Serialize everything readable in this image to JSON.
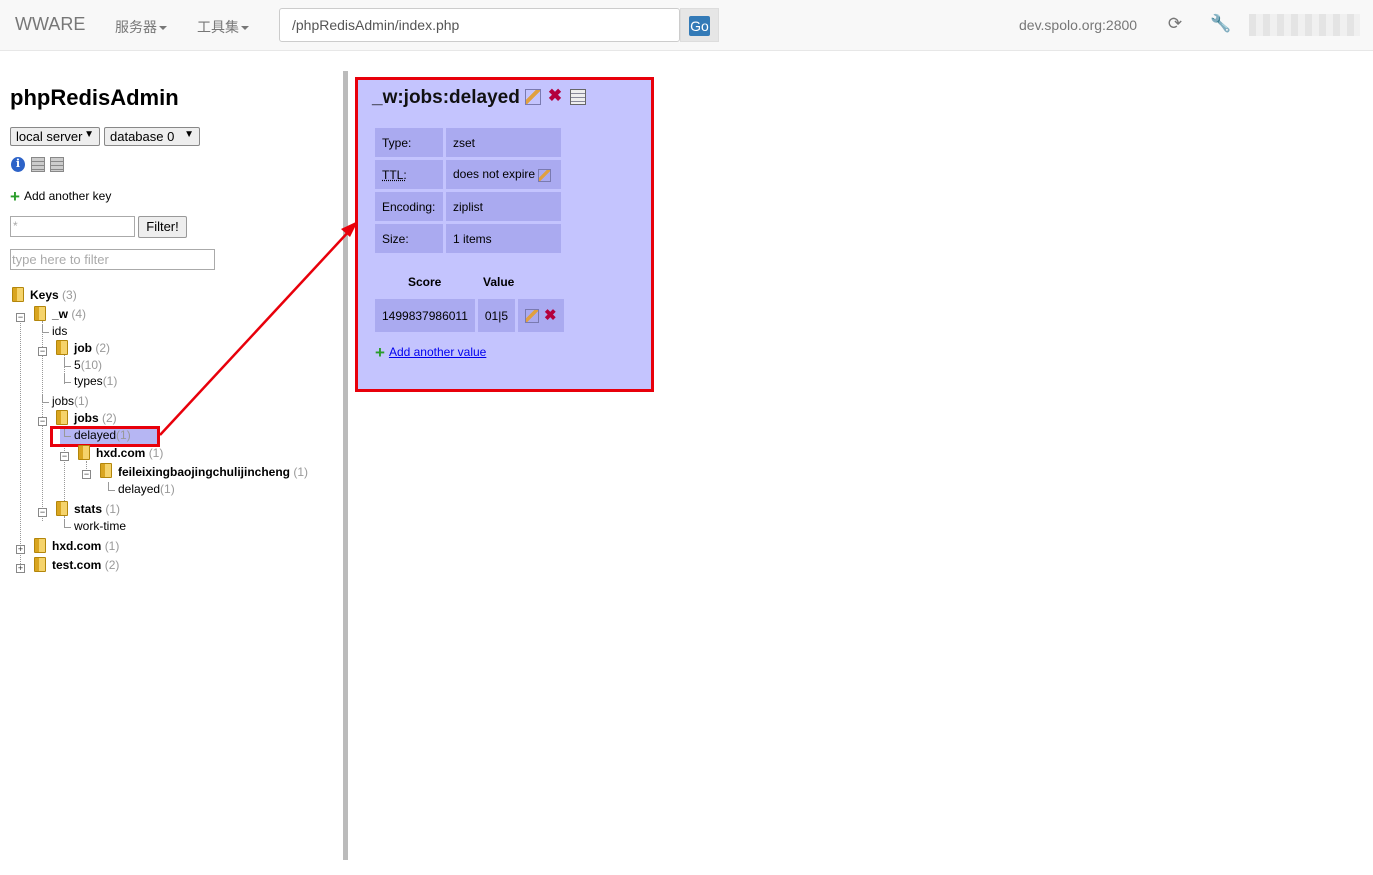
{
  "topbar": {
    "brand": "WWARE",
    "menu_servers": "服务器",
    "menu_tools": "工具集",
    "url": "/phpRedisAdmin/index.php",
    "go": "Go",
    "host": "dev.spolo.org:2800"
  },
  "sidebar": {
    "title": "phpRedisAdmin",
    "server_select": "local server",
    "database_select": "database 0",
    "add_key": "Add another key",
    "filter_value": "*",
    "filter_button": "Filter!",
    "type_filter_placeholder": "type here to filter"
  },
  "tree": {
    "keys": {
      "label": "Keys",
      "count": "(3)"
    },
    "w": {
      "label": "_w",
      "count": "(4)"
    },
    "ids": {
      "label": "ids"
    },
    "job": {
      "label": "job",
      "count": "(2)"
    },
    "job5": {
      "label": "5",
      "count": "(10)"
    },
    "types": {
      "label": "types",
      "count": "(1)"
    },
    "jobs_leaf": {
      "label": "jobs",
      "count": "(1)"
    },
    "jobs": {
      "label": "jobs",
      "count": "(2)"
    },
    "delayed": {
      "label": "delayed",
      "count": "(1)"
    },
    "hxd_inner": {
      "label": "hxd.com",
      "count": "(1)"
    },
    "feilei": {
      "label": "feileixingbaojingchulijincheng",
      "count": "(1)"
    },
    "delayed2": {
      "label": "delayed",
      "count": "(1)"
    },
    "stats": {
      "label": "stats",
      "count": "(1)"
    },
    "worktime": {
      "label": "work-time"
    },
    "hxd": {
      "label": "hxd.com",
      "count": "(1)"
    },
    "test": {
      "label": "test.com",
      "count": "(2)"
    }
  },
  "panel": {
    "key_name": "_w:jobs:delayed",
    "info": [
      {
        "label": "Type:",
        "value": "zset"
      },
      {
        "label": "TTL:",
        "value": "does not expire"
      },
      {
        "label": "Encoding:",
        "value": "ziplist"
      },
      {
        "label": "Size:",
        "value": "1 items"
      }
    ],
    "score_header": "Score",
    "value_header": "Value",
    "rows": [
      {
        "score": "1499837986011",
        "value": "01|5"
      }
    ],
    "add_value": "Add another value"
  },
  "colors": {
    "highlight": "#e8000b",
    "panel_bg": "#c4c4fe",
    "cell_bg": "#aaaaf0"
  }
}
